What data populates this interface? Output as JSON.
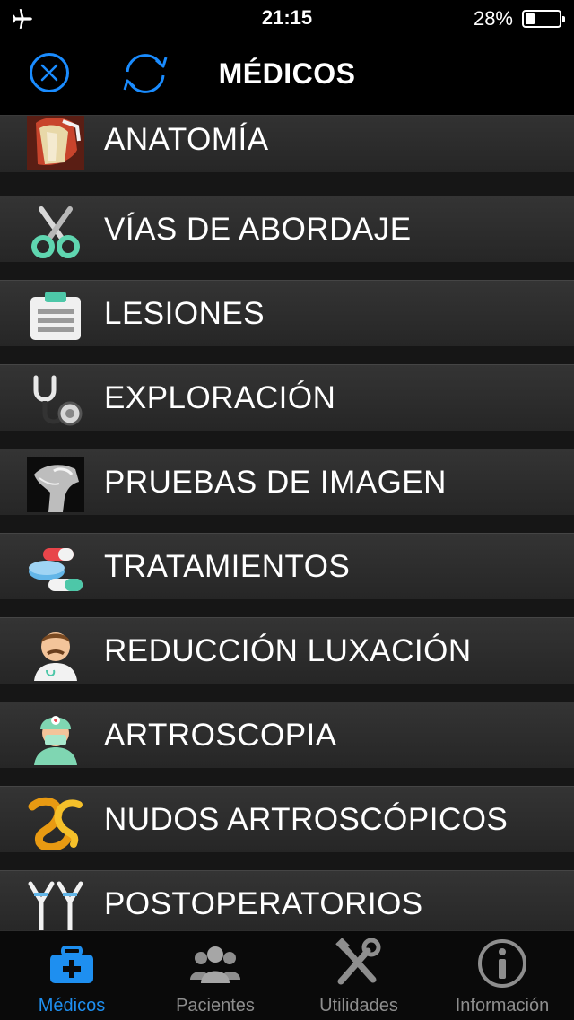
{
  "status_bar": {
    "time": "21:15",
    "battery_percent_label": "28%",
    "battery_level": 0.28,
    "airplane_mode_icon": "airplane-icon"
  },
  "nav": {
    "title": "MÉDICOS",
    "left_icon": "close-circle-icon",
    "second_icon": "refresh-icon",
    "accent_color": "#1a8cff"
  },
  "menu": {
    "items": [
      {
        "label": "ANATOMÍA",
        "icon": "anatomy-shoulder-icon"
      },
      {
        "label": "VÍAS DE ABORDAJE",
        "icon": "scissors-icon"
      },
      {
        "label": "LESIONES",
        "icon": "clipboard-icon"
      },
      {
        "label": "EXPLORACIÓN",
        "icon": "stethoscope-icon"
      },
      {
        "label": "PRUEBAS DE IMAGEN",
        "icon": "xray-icon"
      },
      {
        "label": "TRATAMIENTOS",
        "icon": "pills-icon"
      },
      {
        "label": "REDUCCIÓN LUXACIÓN",
        "icon": "doctor-icon"
      },
      {
        "label": "ARTROSCOPIA",
        "icon": "surgeon-icon"
      },
      {
        "label": "NUDOS ARTROSCÓPICOS",
        "icon": "knot-icon"
      },
      {
        "label": "POSTOPERATORIOS",
        "icon": "crutches-icon"
      }
    ]
  },
  "tabs": [
    {
      "label": "Médicos",
      "icon": "medical-kit-icon",
      "active": true
    },
    {
      "label": "Pacientes",
      "icon": "people-icon",
      "active": false
    },
    {
      "label": "Utilidades",
      "icon": "tools-icon",
      "active": false
    },
    {
      "label": "Información",
      "icon": "info-icon",
      "active": false
    }
  ],
  "colors": {
    "tab_active": "#1e8ff0",
    "tab_inactive": "#8e8e8e"
  }
}
